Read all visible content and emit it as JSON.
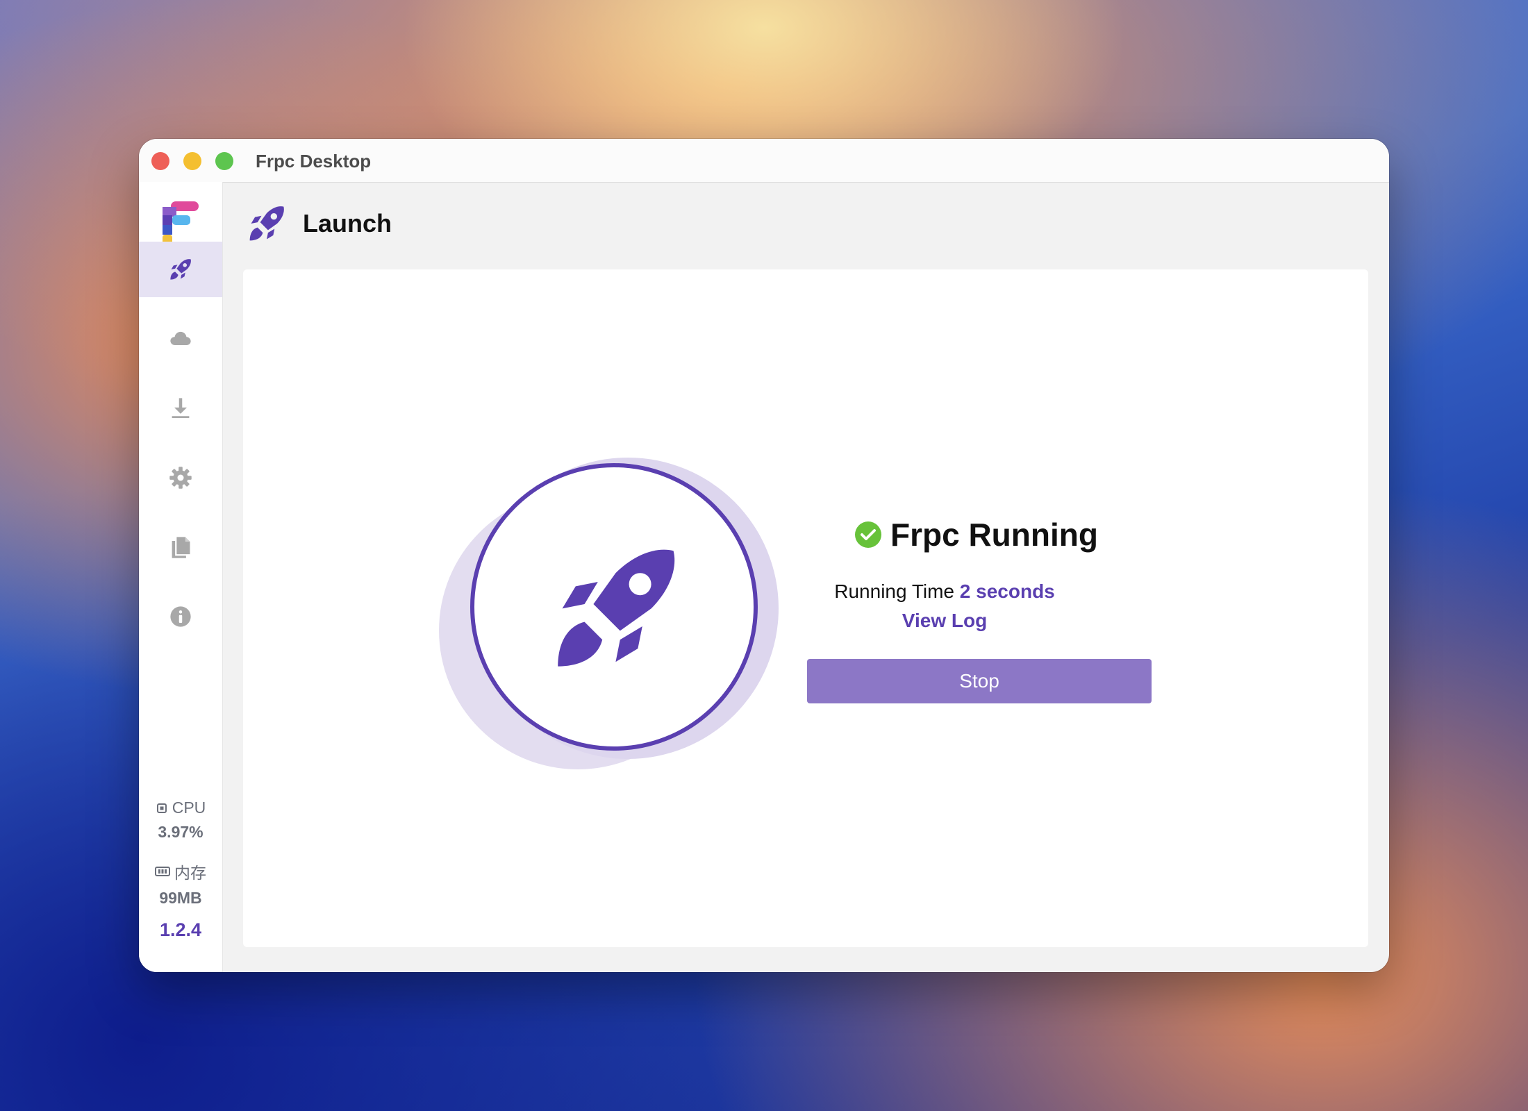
{
  "window": {
    "title": "Frpc Desktop"
  },
  "icons": {
    "logo": "frpc-logo",
    "traffic_lights": [
      "close",
      "minimize",
      "maximize"
    ],
    "nav": [
      "rocket-icon",
      "cloud-icon",
      "download-icon",
      "gear-icon",
      "document-icon",
      "info-icon"
    ]
  },
  "sidebar": {
    "items": [
      {
        "id": "launch",
        "icon": "rocket-icon",
        "active": true
      },
      {
        "id": "cloud",
        "icon": "cloud-icon",
        "active": false
      },
      {
        "id": "download",
        "icon": "download-icon",
        "active": false
      },
      {
        "id": "settings",
        "icon": "gear-icon",
        "active": false
      },
      {
        "id": "logs",
        "icon": "document-icon",
        "active": false
      },
      {
        "id": "about",
        "icon": "info-icon",
        "active": false
      }
    ],
    "cpu_label": "CPU",
    "cpu_value": "3.97%",
    "memory_label": "内存",
    "memory_value": "99MB",
    "version": "1.2.4"
  },
  "header": {
    "title": "Launch"
  },
  "status": {
    "title": "Frpc Running",
    "running_time_label": "Running Time",
    "running_time_value": "2 seconds",
    "view_log": "View Log",
    "stop_button": "Stop"
  },
  "colors": {
    "accent": "#5a3fb0",
    "accent_light": "#e6e2f3",
    "button": "#8c77c6",
    "success": "#67c23a",
    "muted_icon": "#a8a8a8"
  }
}
